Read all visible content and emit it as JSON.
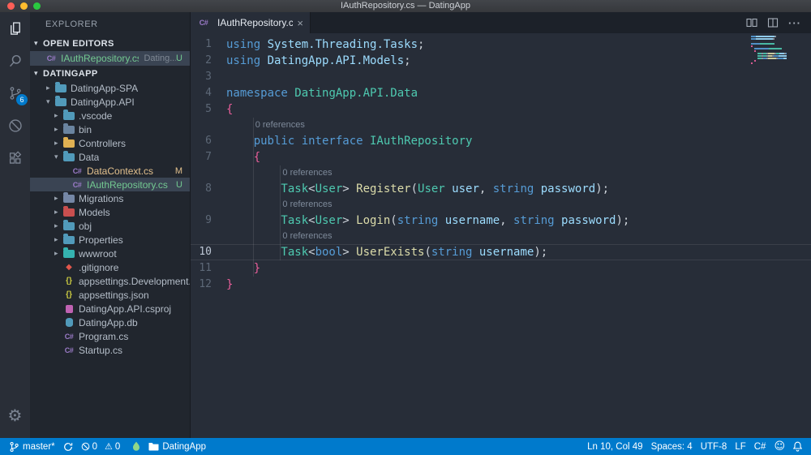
{
  "colors": {
    "statusbar": "#007acc",
    "badge": "#007acc",
    "git_modified": "#e2c08d",
    "git_untracked": "#73c991",
    "keyword": "#569cd6",
    "type": "#4ec9b0",
    "method": "#dcdcaa",
    "parameter": "#9cdcfe",
    "brace": "#ea5f9b"
  },
  "titlebar": {
    "title": "IAuthRepository.cs — DatingApp"
  },
  "activity_bar": {
    "items": [
      {
        "name": "explorer",
        "icon": "files-icon",
        "active": true
      },
      {
        "name": "search",
        "icon": "search-icon"
      },
      {
        "name": "source-control",
        "icon": "source-control-icon",
        "badge": "6"
      },
      {
        "name": "debug",
        "icon": "debug-icon"
      },
      {
        "name": "extensions",
        "icon": "extensions-icon"
      }
    ],
    "bottom": [
      {
        "name": "settings",
        "icon": "gear-icon"
      }
    ]
  },
  "sidebar": {
    "title": "EXPLORER",
    "open_editors": {
      "header": "OPEN EDITORS",
      "items": [
        {
          "label": "IAuthRepository.cs",
          "detail": "Dating...",
          "icon": "csharp",
          "color": "#73c991",
          "badge": "U",
          "selected": true
        }
      ]
    },
    "section": {
      "header": "DATINGAPP"
    },
    "tree": [
      {
        "label": "DatingApp-SPA",
        "type": "folder",
        "level": 1,
        "expanded": false,
        "icon_color": "#519aba"
      },
      {
        "label": "DatingApp.API",
        "type": "folder",
        "level": 1,
        "expanded": true,
        "icon_color": "#519aba"
      },
      {
        "label": ".vscode",
        "type": "folder",
        "level": 2,
        "expanded": false,
        "icon_color": "#519aba"
      },
      {
        "label": "bin",
        "type": "folder",
        "level": 2,
        "expanded": false,
        "icon_color": "#6a84a0"
      },
      {
        "label": "Controllers",
        "type": "folder",
        "level": 2,
        "expanded": false,
        "icon_color": "#e0b152"
      },
      {
        "label": "Data",
        "type": "folder",
        "level": 2,
        "expanded": true,
        "icon_color": "#519aba"
      },
      {
        "label": "DataContext.cs",
        "type": "file",
        "level": 3,
        "icon": "csharp",
        "color": "#e2c08d",
        "badge": "M"
      },
      {
        "label": "IAuthRepository.cs",
        "type": "file",
        "level": 3,
        "icon": "csharp",
        "color": "#73c991",
        "badge": "U",
        "selected": true
      },
      {
        "label": "Migrations",
        "type": "folder",
        "level": 2,
        "expanded": false,
        "icon_color": "#7587a6"
      },
      {
        "label": "Models",
        "type": "folder",
        "level": 2,
        "expanded": false,
        "icon_color": "#c94f4f"
      },
      {
        "label": "obj",
        "type": "folder",
        "level": 2,
        "expanded": false,
        "icon_color": "#519aba"
      },
      {
        "label": "Properties",
        "type": "folder",
        "level": 2,
        "expanded": false,
        "icon_color": "#519aba"
      },
      {
        "label": "wwwroot",
        "type": "folder",
        "level": 2,
        "expanded": false,
        "icon_color": "#35b3b0"
      },
      {
        "label": ".gitignore",
        "type": "file",
        "level": 2,
        "icon": "git"
      },
      {
        "label": "appsettings.Development.js...",
        "type": "file",
        "level": 2,
        "icon": "json"
      },
      {
        "label": "appsettings.json",
        "type": "file",
        "level": 2,
        "icon": "json"
      },
      {
        "label": "DatingApp.API.csproj",
        "type": "file",
        "level": 2,
        "icon": "csproj"
      },
      {
        "label": "DatingApp.db",
        "type": "file",
        "level": 2,
        "icon": "db"
      },
      {
        "label": "Program.cs",
        "type": "file",
        "level": 2,
        "icon": "csharp"
      },
      {
        "label": "Startup.cs",
        "type": "file",
        "level": 2,
        "icon": "csharp"
      }
    ]
  },
  "editor": {
    "tab": {
      "label": "IAuthRepository.cs",
      "icon": "csharp",
      "close": "×"
    },
    "codelens_label": "0 references",
    "lines": [
      {
        "n": 1,
        "indent": 0,
        "tokens": [
          [
            "kw",
            "using "
          ],
          [
            "ns",
            "System.Threading.Tasks"
          ],
          [
            "pun",
            ";"
          ]
        ]
      },
      {
        "n": 2,
        "indent": 0,
        "tokens": [
          [
            "kw",
            "using "
          ],
          [
            "ns",
            "DatingApp.API.Models"
          ],
          [
            "pun",
            ";"
          ]
        ]
      },
      {
        "n": 3,
        "indent": 0,
        "tokens": []
      },
      {
        "n": 4,
        "indent": 0,
        "tokens": [
          [
            "kw",
            "namespace "
          ],
          [
            "type",
            "DatingApp.API.Data"
          ]
        ]
      },
      {
        "n": 5,
        "indent": 0,
        "tokens": [
          [
            "brace",
            "{"
          ]
        ]
      },
      {
        "lens": true,
        "indent": 4
      },
      {
        "n": 6,
        "indent": 4,
        "tokens": [
          [
            "kw",
            "public interface "
          ],
          [
            "type",
            "IAuthRepository"
          ]
        ]
      },
      {
        "n": 7,
        "indent": 4,
        "tokens": [
          [
            "brace",
            "{"
          ]
        ]
      },
      {
        "lens": true,
        "indent": 8
      },
      {
        "n": 8,
        "indent": 8,
        "tokens": [
          [
            "type",
            "Task"
          ],
          [
            "pun",
            "<"
          ],
          [
            "type",
            "User"
          ],
          [
            "pun",
            "> "
          ],
          [
            "fn",
            "Register"
          ],
          [
            "pun",
            "("
          ],
          [
            "type",
            "User"
          ],
          [
            "param",
            " user"
          ],
          [
            "pun",
            ", "
          ],
          [
            "kw",
            "string"
          ],
          [
            "param",
            " password"
          ],
          [
            "pun",
            ");"
          ]
        ]
      },
      {
        "lens": true,
        "indent": 8
      },
      {
        "n": 9,
        "indent": 8,
        "tokens": [
          [
            "type",
            "Task"
          ],
          [
            "pun",
            "<"
          ],
          [
            "type",
            "User"
          ],
          [
            "pun",
            "> "
          ],
          [
            "fn",
            "Login"
          ],
          [
            "pun",
            "("
          ],
          [
            "kw",
            "string"
          ],
          [
            "param",
            " username"
          ],
          [
            "pun",
            ", "
          ],
          [
            "kw",
            "string"
          ],
          [
            "param",
            " password"
          ],
          [
            "pun",
            ");"
          ]
        ]
      },
      {
        "lens": true,
        "indent": 8
      },
      {
        "n": 10,
        "indent": 8,
        "current": true,
        "tokens": [
          [
            "type",
            "Task"
          ],
          [
            "pun",
            "<"
          ],
          [
            "kw",
            "bool"
          ],
          [
            "pun",
            "> "
          ],
          [
            "fn",
            "UserExists"
          ],
          [
            "pun",
            "("
          ],
          [
            "kw",
            "string"
          ],
          [
            "param",
            " username"
          ],
          [
            "pun",
            ");"
          ]
        ]
      },
      {
        "n": 11,
        "indent": 4,
        "tokens": [
          [
            "brace",
            "}"
          ]
        ]
      },
      {
        "n": 12,
        "indent": 0,
        "tokens": [
          [
            "brace",
            "}"
          ]
        ]
      }
    ]
  },
  "status_bar": {
    "left": [
      {
        "name": "git-branch",
        "icon": "git-branch-icon",
        "label": "master*"
      },
      {
        "name": "sync",
        "icon": "sync-icon"
      },
      {
        "name": "problems",
        "parts": [
          {
            "icon": "error-icon",
            "label": "0"
          },
          {
            "icon": "warning-icon",
            "label": "0"
          }
        ]
      },
      {
        "name": "flame",
        "icon": "flame-icon"
      },
      {
        "name": "workspace",
        "icon": "folder-icon",
        "label": "DatingApp"
      }
    ],
    "right": [
      {
        "name": "cursor-position",
        "label": "Ln 10, Col 49"
      },
      {
        "name": "indentation",
        "label": "Spaces: 4"
      },
      {
        "name": "encoding",
        "label": "UTF-8"
      },
      {
        "name": "eol",
        "label": "LF"
      },
      {
        "name": "language-mode",
        "label": "C#"
      },
      {
        "name": "feedback",
        "icon": "smiley-icon"
      },
      {
        "name": "notifications",
        "icon": "bell-icon"
      }
    ]
  }
}
